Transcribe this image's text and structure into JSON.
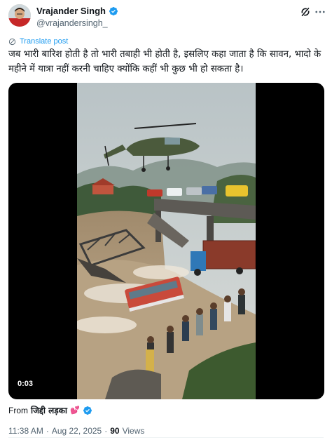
{
  "author": {
    "display_name": "Vrajander Singh",
    "handle": "@vrajandersingh_",
    "verified": true
  },
  "actions": {
    "grok_icon": "grok-icon",
    "more_icon": "more-icon"
  },
  "translate_label": "Translate post",
  "tweet_text": "जब भारी बारिश होती है तो भारी तबाही भी होती है, इसलिए कहा जाता है कि सावन, भादो के महीने में यात्रा नहीं करनी चाहिए क्योंकि कहीं भी कुछ भी हो सकता है।",
  "media": {
    "type": "video",
    "duration": "0:03"
  },
  "from": {
    "label": "From",
    "source_name": "जिद्दी लड़का",
    "emoji": "💕",
    "verified": true
  },
  "meta": {
    "time": "11:38 AM",
    "separator": "·",
    "date": "Aug 22, 2025",
    "views": "90",
    "views_label": "Views"
  },
  "colors": {
    "accent": "#1d9bf0",
    "text": "#0f1419",
    "muted": "#536471"
  }
}
